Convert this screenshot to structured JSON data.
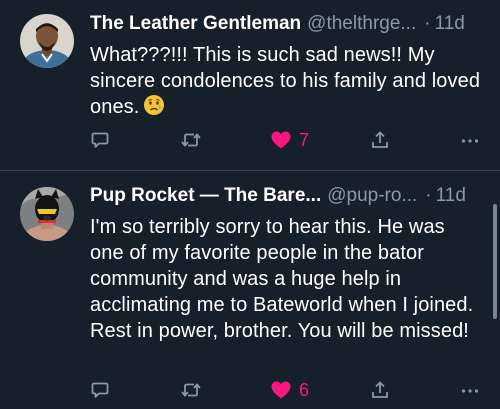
{
  "posts": [
    {
      "name": "The Leather Gentleman",
      "handle": "@thelthrge...",
      "separator": "·",
      "time": "11d",
      "text": "What???!!! This is such sad news!! My sincere condolences to his family and loved ones.",
      "emoji": "crying-face",
      "likes": "7",
      "liked": true
    },
    {
      "name": "Pup Rocket — The Bare...",
      "handle": "@pup-ro...",
      "separator": "·",
      "time": "11d",
      "text": "I'm so terribly sorry to hear this. He was one of my favorite people in the bator community and was a huge help in acclimating me to Bateworld when I joined. Rest in power, brother. You will be missed!",
      "likes": "6",
      "liked": true
    }
  ],
  "colors": {
    "background": "#15202b",
    "secondary_text": "#8b98a5",
    "like": "#f91880",
    "divider": "#38444d"
  },
  "icons": [
    "reply-icon",
    "repost-icon",
    "heart-icon",
    "share-icon",
    "more-icon"
  ]
}
